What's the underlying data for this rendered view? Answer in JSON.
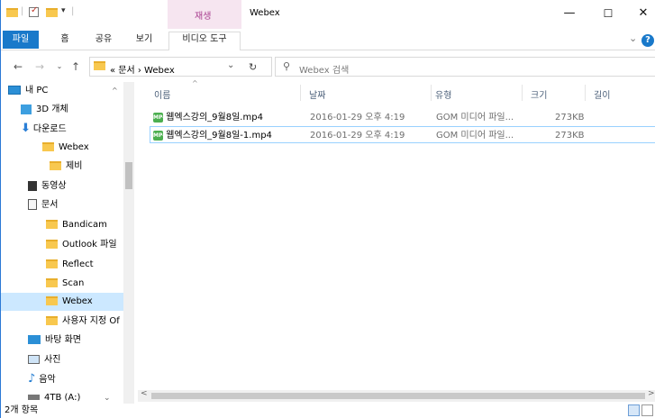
{
  "titlebar": {
    "context_tab": "재생",
    "title": "Webex",
    "minimize": "—",
    "maximize": "☐",
    "close": "✕"
  },
  "ribbon": {
    "tabs": [
      "파일",
      "홈",
      "공유",
      "보기",
      "비디오 도구"
    ],
    "expand": "⌄",
    "help": "?"
  },
  "address": {
    "path": "« 문서 › Webex",
    "search_placeholder": "Webex 검색"
  },
  "nav": {
    "items": [
      {
        "label": "내 PC",
        "icon": "pc-icon"
      },
      {
        "label": "3D 개체",
        "icon": "3d-objects-icon"
      },
      {
        "label": "다운로드",
        "icon": "download-icon"
      },
      {
        "label": "Webex",
        "icon": "folder-icon"
      },
      {
        "label": "제비",
        "icon": "folder-icon"
      },
      {
        "label": "동영상",
        "icon": "video-icon"
      },
      {
        "label": "문서",
        "icon": "document-icon"
      },
      {
        "label": "Bandicam",
        "icon": "folder-icon"
      },
      {
        "label": "Outlook 파일",
        "icon": "folder-icon"
      },
      {
        "label": "Reflect",
        "icon": "folder-icon"
      },
      {
        "label": "Scan",
        "icon": "folder-icon"
      },
      {
        "label": "Webex",
        "icon": "folder-icon"
      },
      {
        "label": "사용자 지정 Of",
        "icon": "folder-icon"
      },
      {
        "label": "바탕 화면",
        "icon": "desktop-icon"
      },
      {
        "label": "사진",
        "icon": "pictures-icon"
      },
      {
        "label": "음악",
        "icon": "music-icon"
      },
      {
        "label": "4TB (A:)",
        "icon": "drive-icon"
      }
    ]
  },
  "columns": {
    "name": "이름",
    "date": "날짜",
    "type": "유형",
    "size": "크기",
    "length": "길이"
  },
  "files": [
    {
      "name": "웹엑스강의_9월8일.mp4",
      "date": "2016-01-29 오후 4:19",
      "type": "GOM 미디어 파일...",
      "size": "273KB"
    },
    {
      "name": "웹엑스강의_9월8일-1.mp4",
      "date": "2016-01-29 오후 4:19",
      "type": "GOM 미디어 파일...",
      "size": "273KB"
    }
  ],
  "status": {
    "count": "2개 항목"
  },
  "colors": {
    "accent": "#1979ca",
    "selection": "#cce8ff",
    "folder": "#f8c84f"
  }
}
